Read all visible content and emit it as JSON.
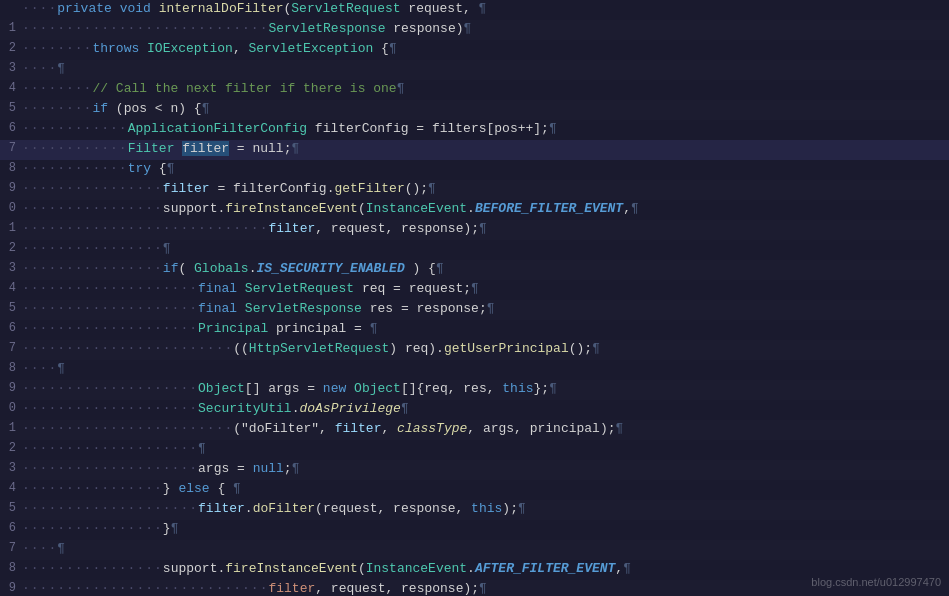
{
  "lines": [
    {
      "num": "",
      "dots": "    ",
      "tokens": [
        {
          "t": "kw",
          "v": "private"
        },
        {
          "t": "plain",
          "v": " "
        },
        {
          "t": "kw",
          "v": "void"
        },
        {
          "t": "plain",
          "v": " "
        },
        {
          "t": "method",
          "v": "internalDoFilter"
        },
        {
          "t": "plain",
          "v": "("
        },
        {
          "t": "type",
          "v": "ServletRequest"
        },
        {
          "t": "plain",
          "v": " request, "
        },
        {
          "t": "pilcrow",
          "v": "¶"
        }
      ]
    },
    {
      "num": "",
      "dots": "                            ",
      "tokens": [
        {
          "t": "type",
          "v": "ServletResponse"
        },
        {
          "t": "plain",
          "v": " response)"
        },
        {
          "t": "pilcrow",
          "v": "¶"
        }
      ]
    },
    {
      "num": "",
      "dots": "        ",
      "tokens": [
        {
          "t": "kw",
          "v": "throws"
        },
        {
          "t": "plain",
          "v": " "
        },
        {
          "t": "type",
          "v": "IOException"
        },
        {
          "t": "plain",
          "v": ", "
        },
        {
          "t": "type",
          "v": "ServletException"
        },
        {
          "t": "plain",
          "v": " {"
        },
        {
          "t": "pilcrow",
          "v": "¶"
        }
      ]
    },
    {
      "num": "",
      "dots": "    ",
      "tokens": [
        {
          "t": "pilcrow",
          "v": "¶"
        }
      ]
    },
    {
      "num": "",
      "dots": "        ",
      "tokens": [
        {
          "t": "comment",
          "v": "// Call the next filter if there is one"
        },
        {
          "t": "pilcrow",
          "v": "¶"
        }
      ]
    },
    {
      "num": "",
      "dots": "        ",
      "tokens": [
        {
          "t": "kw",
          "v": "if"
        },
        {
          "t": "plain",
          "v": " (pos < n) {"
        },
        {
          "t": "pilcrow",
          "v": "¶"
        }
      ]
    },
    {
      "num": "",
      "dots": "            ",
      "tokens": [
        {
          "t": "type",
          "v": "ApplicationFilterConfig"
        },
        {
          "t": "plain",
          "v": " filterConfig = filters[pos++];"
        },
        {
          "t": "pilcrow",
          "v": "¶"
        }
      ]
    },
    {
      "num": "",
      "dots": "            ",
      "highlight": true,
      "tokens": [
        {
          "t": "type",
          "v": "Filter"
        },
        {
          "t": "plain",
          "v": " "
        },
        {
          "t": "highlight",
          "v": "filter"
        },
        {
          "t": "plain",
          "v": " = null;"
        },
        {
          "t": "pilcrow",
          "v": "¶"
        }
      ]
    },
    {
      "num": "",
      "dots": "            ",
      "tokens": [
        {
          "t": "kw",
          "v": "try"
        },
        {
          "t": "plain",
          "v": " {"
        },
        {
          "t": "pilcrow",
          "v": "¶"
        }
      ]
    },
    {
      "num": "",
      "dots": "                ",
      "tokens": [
        {
          "t": "blue-light",
          "v": "filter"
        },
        {
          "t": "plain",
          "v": " = filterConfig."
        },
        {
          "t": "method",
          "v": "getFilter"
        },
        {
          "t": "plain",
          "v": "();"
        },
        {
          "t": "pilcrow",
          "v": "¶"
        }
      ]
    },
    {
      "num": "",
      "dots": "                ",
      "tokens": [
        {
          "t": "plain",
          "v": "support."
        },
        {
          "t": "method",
          "v": "fireInstanceEvent"
        },
        {
          "t": "plain",
          "v": "("
        },
        {
          "t": "type",
          "v": "InstanceEvent"
        },
        {
          "t": "plain",
          "v": "."
        },
        {
          "t": "italic-bold",
          "v": "BEFORE_FILTER_EVENT"
        },
        {
          "t": "plain",
          "v": ","
        },
        {
          "t": "pilcrow",
          "v": "¶"
        }
      ]
    },
    {
      "num": "",
      "dots": "                            ",
      "tokens": [
        {
          "t": "blue-light",
          "v": "filter"
        },
        {
          "t": "plain",
          "v": ", request, response);"
        },
        {
          "t": "pilcrow",
          "v": "¶"
        }
      ]
    },
    {
      "num": "",
      "dots": "                ",
      "tokens": [
        {
          "t": "pilcrow",
          "v": "¶"
        }
      ]
    },
    {
      "num": "",
      "dots": "                ",
      "tokens": [
        {
          "t": "kw",
          "v": "if"
        },
        {
          "t": "plain",
          "v": "( "
        },
        {
          "t": "type",
          "v": "Globals"
        },
        {
          "t": "plain",
          "v": "."
        },
        {
          "t": "italic-bold",
          "v": "IS_SECURITY_ENABLED"
        },
        {
          "t": "plain",
          "v": " ) {"
        },
        {
          "t": "pilcrow",
          "v": "¶"
        }
      ]
    },
    {
      "num": "",
      "dots": "                    ",
      "tokens": [
        {
          "t": "kw",
          "v": "final"
        },
        {
          "t": "plain",
          "v": " "
        },
        {
          "t": "type",
          "v": "ServletRequest"
        },
        {
          "t": "plain",
          "v": " req = request;"
        },
        {
          "t": "pilcrow",
          "v": "¶"
        }
      ]
    },
    {
      "num": "",
      "dots": "                    ",
      "tokens": [
        {
          "t": "kw",
          "v": "final"
        },
        {
          "t": "plain",
          "v": " "
        },
        {
          "t": "type",
          "v": "ServletResponse"
        },
        {
          "t": "plain",
          "v": " res = response;"
        },
        {
          "t": "pilcrow",
          "v": "¶"
        }
      ]
    },
    {
      "num": "",
      "dots": "                    ",
      "tokens": [
        {
          "t": "type",
          "v": "Principal"
        },
        {
          "t": "plain",
          "v": " principal = "
        },
        {
          "t": "pilcrow",
          "v": "¶"
        }
      ]
    },
    {
      "num": "",
      "dots": "                        ",
      "tokens": [
        {
          "t": "plain",
          "v": "(("
        },
        {
          "t": "type",
          "v": "HttpServletRequest"
        },
        {
          "t": "plain",
          "v": ") req)."
        },
        {
          "t": "method",
          "v": "getUserPrincipal"
        },
        {
          "t": "plain",
          "v": "();"
        },
        {
          "t": "pilcrow",
          "v": "¶"
        }
      ]
    },
    {
      "num": "",
      "dots": "    ",
      "tokens": [
        {
          "t": "pilcrow",
          "v": "¶"
        }
      ]
    },
    {
      "num": "",
      "dots": "                    ",
      "tokens": [
        {
          "t": "type",
          "v": "Object"
        },
        {
          "t": "plain",
          "v": "[] args = "
        },
        {
          "t": "kw",
          "v": "new"
        },
        {
          "t": "plain",
          "v": " "
        },
        {
          "t": "type",
          "v": "Object"
        },
        {
          "t": "plain",
          "v": "[]{req, res, "
        },
        {
          "t": "kw",
          "v": "this"
        },
        {
          "t": "plain",
          "v": "};"
        },
        {
          "t": "pilcrow",
          "v": "¶"
        }
      ]
    },
    {
      "num": "",
      "dots": "                    ",
      "tokens": [
        {
          "t": "type",
          "v": "SecurityUtil"
        },
        {
          "t": "plain",
          "v": "."
        },
        {
          "t": "italic",
          "v": "doAsPrivilege"
        },
        {
          "t": "pilcrow",
          "v": "¶"
        }
      ]
    },
    {
      "num": "",
      "dots": "                        ",
      "tokens": [
        {
          "t": "plain",
          "v": "(\"doFilter\", "
        },
        {
          "t": "blue-light",
          "v": "filter"
        },
        {
          "t": "plain",
          "v": ", "
        },
        {
          "t": "italic",
          "v": "classType"
        },
        {
          "t": "plain",
          "v": ", args, principal);"
        },
        {
          "t": "pilcrow",
          "v": "¶"
        }
      ]
    },
    {
      "num": "",
      "dots": "                    ",
      "tokens": [
        {
          "t": "pilcrow",
          "v": "¶"
        }
      ]
    },
    {
      "num": "",
      "dots": "                    ",
      "tokens": [
        {
          "t": "plain",
          "v": "args = "
        },
        {
          "t": "kw",
          "v": "null"
        },
        {
          "t": "plain",
          "v": ";"
        },
        {
          "t": "pilcrow",
          "v": "¶"
        }
      ]
    },
    {
      "num": "",
      "dots": "                ",
      "tokens": [
        {
          "t": "plain",
          "v": "} "
        },
        {
          "t": "kw",
          "v": "else"
        },
        {
          "t": "plain",
          "v": " { "
        },
        {
          "t": "pilcrow",
          "v": "¶"
        }
      ]
    },
    {
      "num": "",
      "dots": "                    ",
      "tokens": [
        {
          "t": "blue-light",
          "v": "filter"
        },
        {
          "t": "plain",
          "v": "."
        },
        {
          "t": "method",
          "v": "doFilter"
        },
        {
          "t": "plain",
          "v": "(request, response, "
        },
        {
          "t": "kw",
          "v": "this"
        },
        {
          "t": "plain",
          "v": ");"
        },
        {
          "t": "pilcrow",
          "v": "¶"
        }
      ]
    },
    {
      "num": "",
      "dots": "                ",
      "tokens": [
        {
          "t": "plain",
          "v": "}"
        },
        {
          "t": "pilcrow",
          "v": "¶"
        }
      ]
    },
    {
      "num": "",
      "dots": "    ",
      "tokens": [
        {
          "t": "pilcrow",
          "v": "¶"
        }
      ]
    },
    {
      "num": "",
      "dots": "                ",
      "tokens": [
        {
          "t": "plain",
          "v": "support."
        },
        {
          "t": "method",
          "v": "fireInstanceEvent"
        },
        {
          "t": "plain",
          "v": "("
        },
        {
          "t": "type",
          "v": "InstanceEvent"
        },
        {
          "t": "plain",
          "v": "."
        },
        {
          "t": "italic-bold",
          "v": "AFTER_FILTER_EVENT"
        },
        {
          "t": "plain",
          "v": ","
        },
        {
          "t": "pilcrow",
          "v": "¶"
        }
      ]
    },
    {
      "num": "",
      "dots": "                            ",
      "tokens": [
        {
          "t": "orange",
          "v": "filter"
        },
        {
          "t": "plain",
          "v": ", request, response);"
        },
        {
          "t": "pilcrow",
          "v": "¶"
        }
      ]
    }
  ],
  "watermark": "blog.csdn.net/u012997470"
}
